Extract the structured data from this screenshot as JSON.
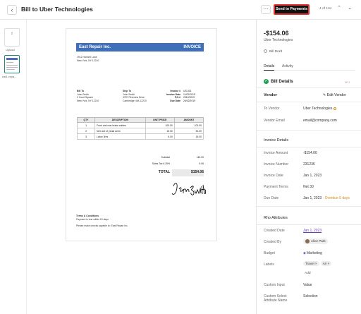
{
  "header": {
    "back_icon": "chevron-left-icon",
    "title": "Bill to Uber Technologies",
    "more_label": "···",
    "send_button": "Send to Payments",
    "pager": "4 of 134"
  },
  "thumbnails": {
    "upload_label": "Upload",
    "doc_label": "eaf1-repa..."
  },
  "invoice": {
    "company": "East Repair Inc.",
    "word": "INVOICE",
    "address": [
      "1912 Harvest Lane",
      "New York, NY 12210"
    ],
    "bill_to": {
      "heading": "Bill To",
      "lines": [
        "John Smith",
        "2 Court Square",
        "New York, NY 12210"
      ]
    },
    "ship_to": {
      "heading": "Ship To",
      "lines": [
        "John Smith",
        "3787 Pineview Drive",
        "Cambridge, MA 12210"
      ]
    },
    "meta_labels": [
      "Invoice #",
      "Invoice Date",
      "P.O.#",
      "Due Date"
    ],
    "meta_values": [
      "US-001",
      "11/02/2019",
      "2312/2019",
      "26/02/2019"
    ],
    "table_headers": [
      "QTY",
      "DESCRIPTION",
      "UNIT PRICE",
      "AMOUNT"
    ],
    "rows": [
      {
        "qty": "1",
        "desc": "Front and rear brake cables",
        "price": "100.00",
        "amount": "100.00"
      },
      {
        "qty": "2",
        "desc": "New set of pedal arms",
        "price": "15.00",
        "amount": "30.00"
      },
      {
        "qty": "3",
        "desc": "Labor 3hrs",
        "price": "5.00",
        "amount": "15.00"
      }
    ],
    "subtotal_label": "Subtotal",
    "subtotal": "145.00",
    "tax_label": "Sales Tax 6.25%",
    "tax": "9.06",
    "total_label": "TOTAL",
    "total": "$154.06",
    "signature": "John Smith",
    "terms_heading": "Terms & Conditions",
    "terms_line1": "Payment is due within 15 days",
    "terms_line2": "Please make checks payable to: East Repair Inc."
  },
  "panel": {
    "amount": "-$154.06",
    "vendor_sub": "Uber Technologies",
    "status": "Bill Draft",
    "tabs": [
      "Details",
      "Activity"
    ],
    "bill_details": "Bill Details",
    "vendor_section": "Vendor",
    "edit_vendor": "Edit Vendor",
    "to_vendor_label": "To Vendor",
    "to_vendor_value": "Uber Technologies",
    "vendor_email_label": "Vendor Email",
    "vendor_email_value": "email@company.com",
    "invoice_details": "Invoice Details",
    "invoice_amount_label": "Invoice Amount",
    "invoice_amount_value": "-$154.06",
    "invoice_number_label": "Invoice Number",
    "invoice_number_value": "231236",
    "invoice_date_label": "Invoice Date",
    "invoice_date_value": "Jan 1, 2023",
    "payment_terms_label": "Payment Terms",
    "payment_terms_value": "Net 30",
    "due_date_label": "Due Date",
    "due_date_value": "Jan 1, 2023",
    "overdue": "· Overdue 5 days",
    "attrs_section": "Rho Attributes",
    "created_date_label": "Created Date",
    "created_date_value": "Jan 1, 2023",
    "created_by_label": "Created By",
    "created_by_value": "Alice Park",
    "budget_label": "Budget",
    "budget_value": "Marketing",
    "labels_label": "Labels",
    "label_pills": [
      "Travel",
      "Air"
    ],
    "add_label": "Add",
    "custom_input_label": "Custom Input",
    "custom_input_value": "Value",
    "custom_select_label": "Custom Select Attribute Name",
    "custom_select_value": "Selection"
  }
}
